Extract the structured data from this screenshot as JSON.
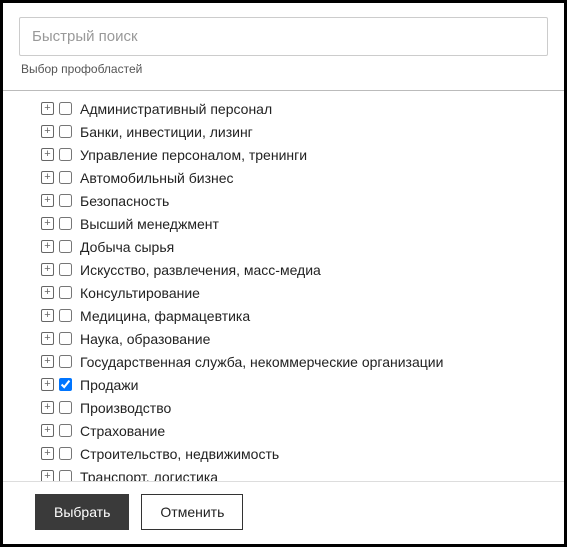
{
  "search": {
    "placeholder": "Быстрый поиск"
  },
  "subtitle": "Выбор профобластей",
  "categories": [
    {
      "label": "Административный персонал",
      "checked": false
    },
    {
      "label": "Банки, инвестиции, лизинг",
      "checked": false
    },
    {
      "label": "Управление персоналом, тренинги",
      "checked": false
    },
    {
      "label": "Автомобильный бизнес",
      "checked": false
    },
    {
      "label": "Безопасность",
      "checked": false
    },
    {
      "label": "Высший менеджмент",
      "checked": false
    },
    {
      "label": "Добыча сырья",
      "checked": false
    },
    {
      "label": "Искусство, развлечения, масс-медиа",
      "checked": false
    },
    {
      "label": "Консультирование",
      "checked": false
    },
    {
      "label": "Медицина, фармацевтика",
      "checked": false
    },
    {
      "label": "Наука, образование",
      "checked": false
    },
    {
      "label": "Государственная служба, некоммерческие организации",
      "checked": false
    },
    {
      "label": "Продажи",
      "checked": true
    },
    {
      "label": "Производство",
      "checked": false
    },
    {
      "label": "Страхование",
      "checked": false
    },
    {
      "label": "Строительство, недвижимость",
      "checked": false
    },
    {
      "label": "Транспорт, логистика",
      "checked": false
    }
  ],
  "buttons": {
    "select": "Выбрать",
    "cancel": "Отменить"
  },
  "expand_glyph": "+"
}
